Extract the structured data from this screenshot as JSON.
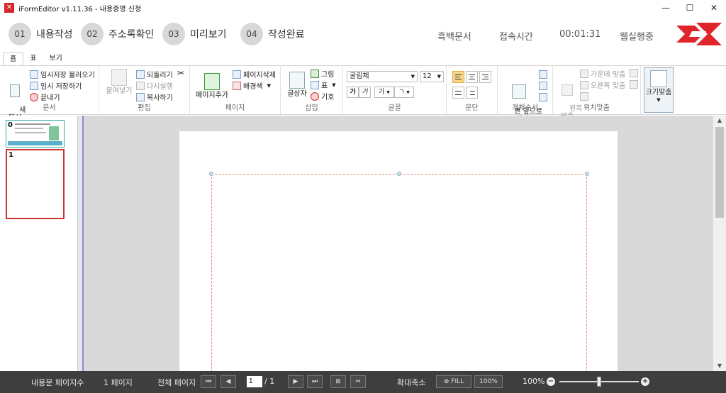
{
  "window": {
    "title": "iFormEditor v1.11.36 - 내용증명 신청",
    "minimize": "—",
    "maximize": "☐",
    "close": "✕"
  },
  "steps": [
    {
      "num": "01",
      "label": "내용작성"
    },
    {
      "num": "02",
      "label": "주소록확인"
    },
    {
      "num": "03",
      "label": "미리보기"
    },
    {
      "num": "04",
      "label": "작성완료"
    }
  ],
  "header": {
    "mode": "흑백문서",
    "elapsed_label": "접속시간",
    "elapsed_value": "00:01:31",
    "status": "웹실행중"
  },
  "tabs": [
    "홈",
    "표",
    "보기"
  ],
  "ribbon": {
    "document": {
      "new": "새\n문서",
      "load_temp": "임시저장 불러오기",
      "save_temp": "임시 저장하기",
      "exit": "끝내기",
      "label": "문서"
    },
    "edit": {
      "paste": "붙여넣기",
      "undo": "되돌리기",
      "redo": "다시실행",
      "copy": "복사하기",
      "label": "편집"
    },
    "page": {
      "add": "페이지추가",
      "delete": "페이지삭제",
      "background": "배경색",
      "label": "페이지"
    },
    "insert": {
      "textbox": "글상자",
      "image": "그림",
      "table": "표",
      "symbol": "기호",
      "label": "삽입"
    },
    "font": {
      "family": "굴림체",
      "size": "12",
      "bold": "가",
      "italic": "가",
      "grow": "가",
      "shrink": "ㄱ",
      "label": "글꼴"
    },
    "paragraph": {
      "label": "문단"
    },
    "order": {
      "front": "맨 앞으로\n보내기",
      "label": "개체순서"
    },
    "position": {
      "left": "왼쪽\n맞춤",
      "center": "가운데 맞춤",
      "right": "오른쪽 맞춤",
      "label": "위치맞춤"
    },
    "size": {
      "fit": "크기맞춤"
    }
  },
  "thumbnails": [
    {
      "num": "0"
    },
    {
      "num": "1"
    }
  ],
  "status": {
    "content_pages_label": "내용문 페이지수",
    "content_pages_value": "1 페이지",
    "total_pages_label": "전체 페이지",
    "current_page": "1",
    "page_sep": "/ 1",
    "zoom_label": "확대축소",
    "fill": "FILL",
    "zoom_100": "100%",
    "zoom_value": "100%",
    "zoom_fraction": 0.5
  }
}
